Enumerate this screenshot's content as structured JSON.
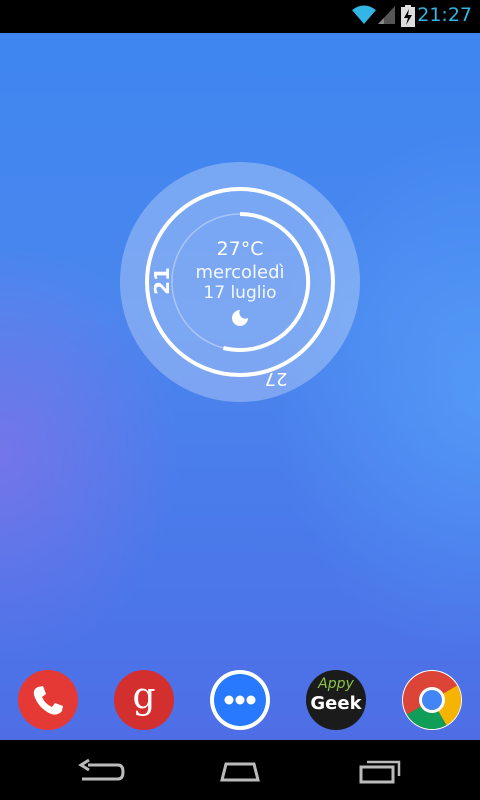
{
  "status_bar": {
    "time": "21:27",
    "icons": [
      "wifi-icon",
      "signal-icon",
      "battery-charging-icon"
    ],
    "accent_color": "#33b5e5"
  },
  "widget": {
    "temperature": "27°C",
    "day": "mercoledì",
    "date": "17 luglio",
    "hour": "21",
    "minute": "27",
    "weather_icon": "moon-icon"
  },
  "dock": {
    "apps": [
      {
        "name": "phone",
        "icon": "phone-icon",
        "color": "#e53935"
      },
      {
        "name": "google",
        "icon": "google-icon",
        "letter": "g",
        "color": "#d32f2f"
      },
      {
        "name": "app-drawer",
        "icon": "app-drawer-icon",
        "color": "#2979ff"
      },
      {
        "name": "appy-geek",
        "icon": "appy-geek-icon",
        "text_top": "Appy",
        "text_bottom": "Geek"
      },
      {
        "name": "chrome",
        "icon": "chrome-icon"
      }
    ]
  },
  "nav_bar": {
    "buttons": [
      "back-icon",
      "home-icon",
      "recent-apps-icon"
    ]
  }
}
